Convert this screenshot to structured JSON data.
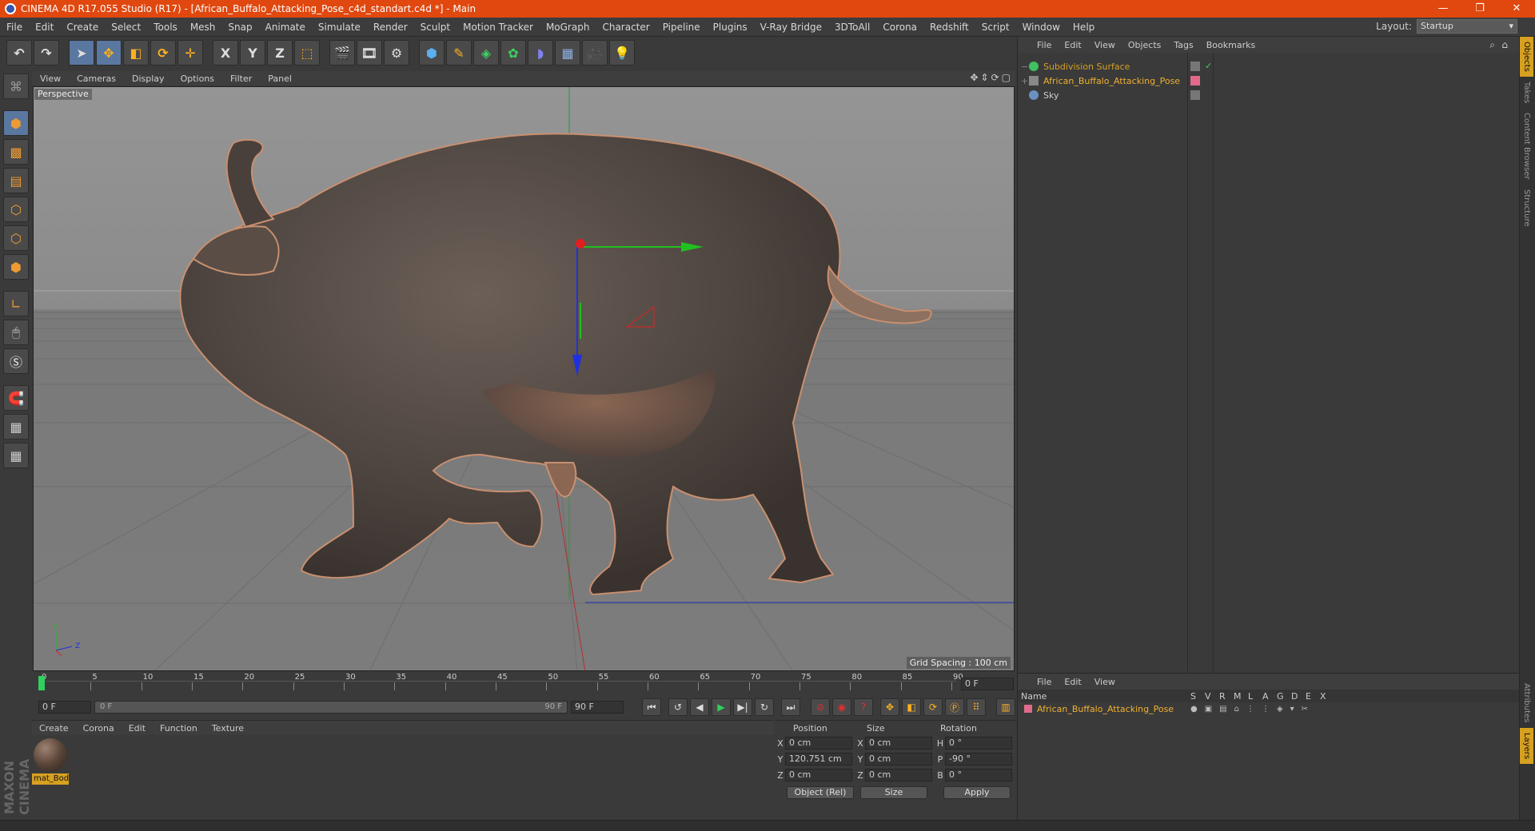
{
  "window": {
    "title": "CINEMA 4D R17.055 Studio (R17) - [African_Buffalo_Attacking_Pose_c4d_standart.c4d *] - Main",
    "controls": [
      "—",
      "❐",
      "✕"
    ]
  },
  "menubar": {
    "items": [
      "File",
      "Edit",
      "Create",
      "Select",
      "Tools",
      "Mesh",
      "Snap",
      "Animate",
      "Simulate",
      "Render",
      "Sculpt",
      "Motion Tracker",
      "MoGraph",
      "Character",
      "Pipeline",
      "Plugins",
      "V-Ray Bridge",
      "3DToAll",
      "Corona",
      "Redshift",
      "Script",
      "Window",
      "Help"
    ],
    "layout_label": "Layout:",
    "layout_value": "Startup"
  },
  "toolbar": {
    "axis_x": "X",
    "axis_y": "Y",
    "axis_z": "Z"
  },
  "viewport": {
    "menu": [
      "View",
      "Cameras",
      "Display",
      "Options",
      "Filter",
      "Panel"
    ],
    "camera_label": "Perspective",
    "grid_spacing": "Grid Spacing : 100 cm",
    "nav_icons": [
      "✥",
      "⇕",
      "⟳",
      "▢"
    ],
    "axis_labels": {
      "y": "Y",
      "z": "Z"
    }
  },
  "timeline": {
    "ticks": [
      "0",
      "5",
      "10",
      "15",
      "20",
      "25",
      "30",
      "35",
      "40",
      "45",
      "50",
      "55",
      "60",
      "65",
      "70",
      "75",
      "80",
      "85",
      "90"
    ],
    "current_frame": "0 F",
    "start_field": "0 F",
    "range_start": "0 F",
    "range_end": "90 F",
    "end_field": "90 F"
  },
  "material_panel": {
    "menu": [
      "Create",
      "Corona",
      "Edit",
      "Function",
      "Texture"
    ],
    "material_name": "mat_Bod"
  },
  "coordinates": {
    "headers": [
      "Position",
      "Size",
      "Rotation"
    ],
    "rows": [
      {
        "axis": "X",
        "pos": "0 cm",
        "size_axis": "X",
        "size": "0 cm",
        "rot_axis": "H",
        "rot": "0 °"
      },
      {
        "axis": "Y",
        "pos": "120.751 cm",
        "size_axis": "Y",
        "size": "0 cm",
        "rot_axis": "P",
        "rot": "-90 °"
      },
      {
        "axis": "Z",
        "pos": "0 cm",
        "size_axis": "Z",
        "size": "0 cm",
        "rot_axis": "B",
        "rot": "0 °"
      }
    ],
    "mode_dropdown": "Object (Rel)",
    "size_dropdown": "Size",
    "apply_label": "Apply"
  },
  "object_manager": {
    "menu": [
      "File",
      "Edit",
      "View",
      "Objects",
      "Tags",
      "Bookmarks"
    ],
    "objects": [
      {
        "name": "Subdivision Surface",
        "color": "#d7a020"
      },
      {
        "name": "African_Buffalo_Attacking_Pose",
        "color": "#f0b030"
      },
      {
        "name": "Sky",
        "color": "#cfcfcf"
      }
    ]
  },
  "right_tabs": [
    "Objects",
    "Takes",
    "Content Browser",
    "Structure",
    "Attributes",
    "Layers"
  ],
  "layer_manager": {
    "menu": [
      "File",
      "Edit",
      "View"
    ],
    "columns": [
      "Name",
      "S",
      "V",
      "R",
      "M",
      "L",
      "A",
      "G",
      "D",
      "E",
      "X"
    ],
    "layers": [
      {
        "name": "African_Buffalo_Attacking_Pose",
        "color": "#e06a8a"
      }
    ]
  },
  "branding": "MAXON CINEMA 4D",
  "colors": {
    "titlebar": "#e0480f",
    "accent_orange": "#d7a020",
    "selected_tool": "#5a77a0",
    "axis_x": "#e02020",
    "axis_y": "#20c020",
    "axis_z": "#2030e0"
  }
}
